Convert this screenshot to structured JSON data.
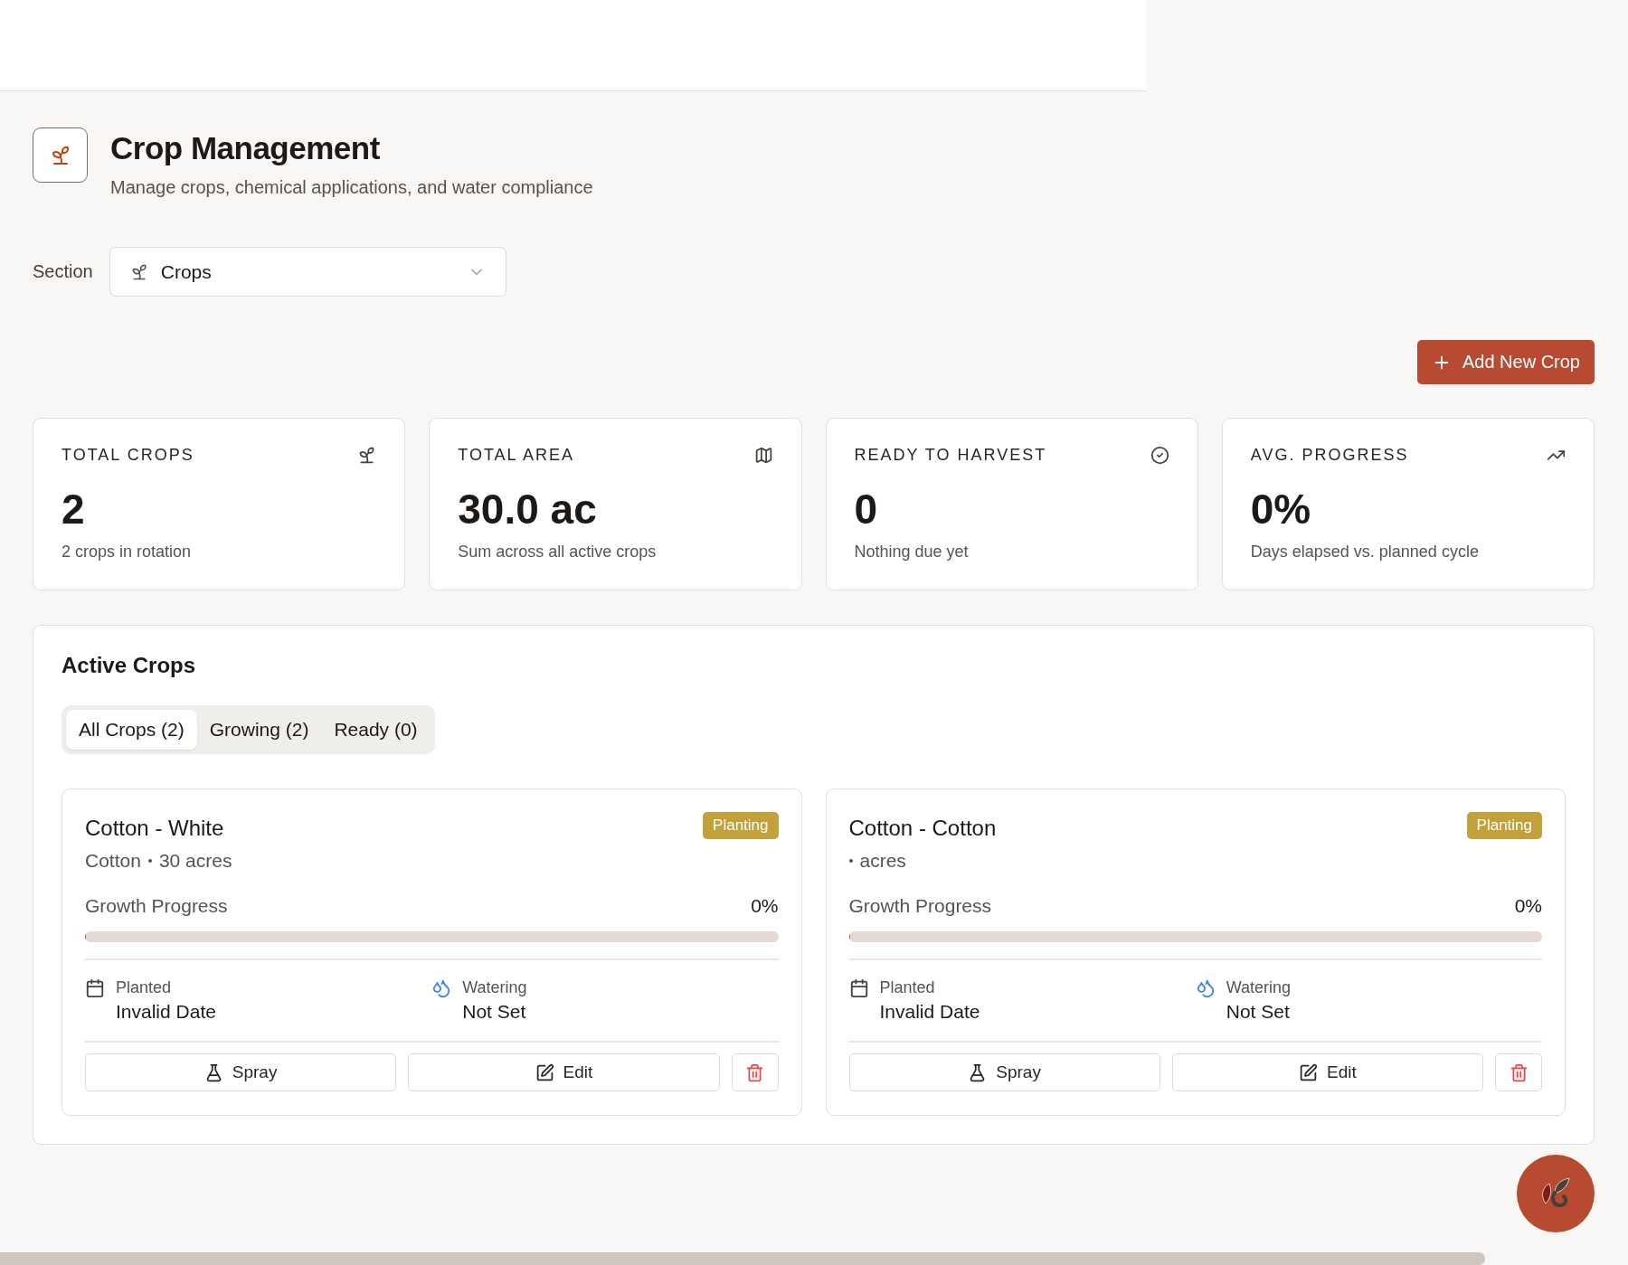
{
  "header": {
    "title": "Crop Management",
    "subtitle": "Manage crops, chemical applications, and water compliance"
  },
  "section": {
    "label": "Section",
    "value": "Crops"
  },
  "add_button": "Add New Crop",
  "stats": [
    {
      "kind": "sprout",
      "label": "TOTAL CROPS",
      "value": "2",
      "note": "2 crops in rotation"
    },
    {
      "kind": "map",
      "label": "TOTAL AREA",
      "value": "30.0 ac",
      "note": "Sum across all active crops"
    },
    {
      "kind": "check",
      "label": "READY TO HARVEST",
      "value": "0",
      "note": "Nothing due yet"
    },
    {
      "kind": "trend",
      "label": "AVG. PROGRESS",
      "value": "0%",
      "note": "Days elapsed vs. planned cycle"
    }
  ],
  "active_crops": {
    "title": "Active Crops",
    "tabs": [
      {
        "label": "All Crops (2)",
        "selected": true
      },
      {
        "label": "Growing (2)",
        "selected": false
      },
      {
        "label": "Ready (0)",
        "selected": false
      }
    ],
    "crops": [
      {
        "name": "Cotton - White",
        "status": "Planting",
        "crop_type": "Cotton",
        "area": "30 acres",
        "progress_label": "Growth Progress",
        "progress_text": "0%",
        "level": 0,
        "planted_label": "Planted",
        "planted": "Invalid Date",
        "watering_label": "Watering",
        "watering": "Not Set",
        "actions": [
          "Spray",
          "Edit"
        ]
      },
      {
        "name": "Cotton - Cotton",
        "status": "Planting",
        "area": "acres",
        "progress_label": "Growth Progress",
        "progress_text": "0%",
        "level": 0,
        "planted_label": "Planted",
        "planted": "Invalid Date",
        "watering_label": "Watering",
        "watering": "Not Set",
        "actions": [
          "Spray",
          "Edit"
        ]
      }
    ]
  }
}
